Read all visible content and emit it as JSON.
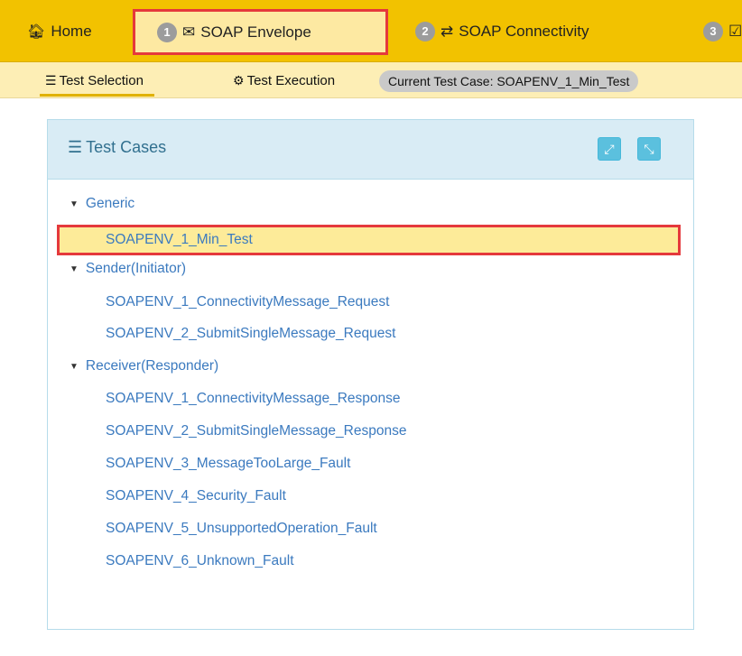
{
  "topnav": {
    "home": {
      "icon": "home-icon",
      "glyph": "🏠︎",
      "label": "Home"
    },
    "tabs": [
      {
        "badge": "1",
        "icon": "envelope-icon",
        "glyph": "✉",
        "label": "SOAP Envelope"
      },
      {
        "badge": "2",
        "icon": "exchange-icon",
        "glyph": "⇄",
        "label": "SOAP Connectivity"
      },
      {
        "badge": "3",
        "icon": "checkbox-icon",
        "glyph": "☑",
        "label": ""
      }
    ]
  },
  "subnav": {
    "selection": {
      "icon": "list-icon",
      "glyph": "☰",
      "label": "Test Selection"
    },
    "execution": {
      "icon": "cogs-icon",
      "glyph": "⚙",
      "label": "Test Execution"
    },
    "current_case": "Current Test Case: SOAPENV_1_Min_Test"
  },
  "panel": {
    "title_icon": "list-icon",
    "title_glyph": "☰",
    "title": "Test Cases",
    "expand_glyph": "⤢",
    "collapse_glyph": "⤡",
    "groups": [
      {
        "label": "Generic",
        "items": [
          "SOAPENV_1_Min_Test"
        ]
      },
      {
        "label": "Sender(Initiator)",
        "items": [
          "SOAPENV_1_ConnectivityMessage_Request",
          "SOAPENV_2_SubmitSingleMessage_Request"
        ]
      },
      {
        "label": "Receiver(Responder)",
        "items": [
          "SOAPENV_1_ConnectivityMessage_Response",
          "SOAPENV_2_SubmitSingleMessage_Response",
          "SOAPENV_3_MessageTooLarge_Fault",
          "SOAPENV_4_Security_Fault",
          "SOAPENV_5_UnsupportedOperation_Fault",
          "SOAPENV_6_Unknown_Fault"
        ]
      }
    ],
    "selected_item": "SOAPENV_1_Min_Test",
    "caret_glyph": "▼"
  },
  "colors": {
    "nav_yellow": "#f2c200",
    "subnav_yellow": "#fdeeb5",
    "highlight_red": "#e5393c",
    "link_blue": "#3b7abf",
    "panel_header": "#d9ecf5"
  }
}
